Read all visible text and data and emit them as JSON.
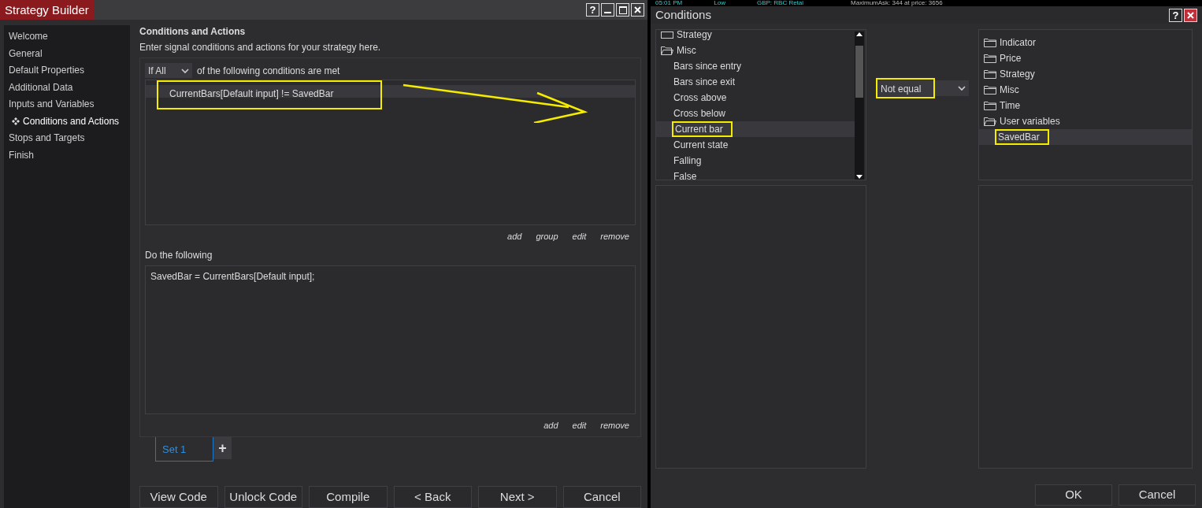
{
  "background_strip": {
    "texts": [
      "05:01 PM",
      "Low",
      "GBP: RBC Retai",
      "MaximumAsk: 344 at price: 3656"
    ]
  },
  "strategy_builder": {
    "title": "Strategy Builder",
    "help": "?",
    "sidebar": [
      {
        "label": "Welcome",
        "selected": false
      },
      {
        "label": "General",
        "selected": false
      },
      {
        "label": "Default Properties",
        "selected": false
      },
      {
        "label": "Additional Data",
        "selected": false
      },
      {
        "label": "Inputs and Variables",
        "selected": false
      },
      {
        "label": "Conditions and Actions",
        "selected": true
      },
      {
        "label": "Stops and Targets",
        "selected": false
      },
      {
        "label": "Finish",
        "selected": false
      }
    ],
    "heading": "Conditions and Actions",
    "subtitle": "Enter signal conditions and actions for your strategy here.",
    "match_select": {
      "value": "If All"
    },
    "match_text": "of the following conditions are met",
    "conditions": [
      {
        "text": "CurrentBars[Default input] != SavedBar",
        "highlighted": true
      }
    ],
    "condition_links": [
      "add",
      "group",
      "edit",
      "remove"
    ],
    "actions_label": "Do the following",
    "actions": [
      "SavedBar = CurrentBars[Default input];"
    ],
    "action_links": [
      "add",
      "edit",
      "remove"
    ],
    "sets": [
      {
        "label": "Set 1",
        "selected": true
      }
    ],
    "add_set": "+",
    "buttons": [
      "View Code",
      "Unlock Code",
      "Compile",
      "< Back",
      "Next >",
      "Cancel"
    ]
  },
  "conditions_dialog": {
    "title": "Conditions",
    "help": "?",
    "left_tree": [
      {
        "label": "Strategy",
        "expanded": false
      },
      {
        "label": "Misc",
        "expanded": true,
        "children": [
          {
            "label": "Bars since entry",
            "selected": false,
            "highlighted": false
          },
          {
            "label": "Bars since exit",
            "selected": false,
            "highlighted": false
          },
          {
            "label": "Cross above",
            "selected": false,
            "highlighted": false
          },
          {
            "label": "Cross below",
            "selected": false,
            "highlighted": false
          },
          {
            "label": "Current bar",
            "selected": true,
            "highlighted": true
          },
          {
            "label": "Current state",
            "selected": false,
            "highlighted": false
          },
          {
            "label": "Falling",
            "selected": false,
            "highlighted": false
          },
          {
            "label": "False",
            "selected": false,
            "highlighted": false
          }
        ]
      }
    ],
    "operator": {
      "value": "Not equal",
      "highlighted": true
    },
    "right_tree": [
      {
        "label": "Indicator",
        "expanded": false
      },
      {
        "label": "Price",
        "expanded": false
      },
      {
        "label": "Strategy",
        "expanded": false
      },
      {
        "label": "Misc",
        "expanded": false
      },
      {
        "label": "Time",
        "expanded": false
      },
      {
        "label": "User variables",
        "expanded": true,
        "children": [
          {
            "label": "SavedBar",
            "selected": true,
            "highlighted": true
          }
        ]
      }
    ],
    "buttons": [
      "OK",
      "Cancel"
    ]
  }
}
